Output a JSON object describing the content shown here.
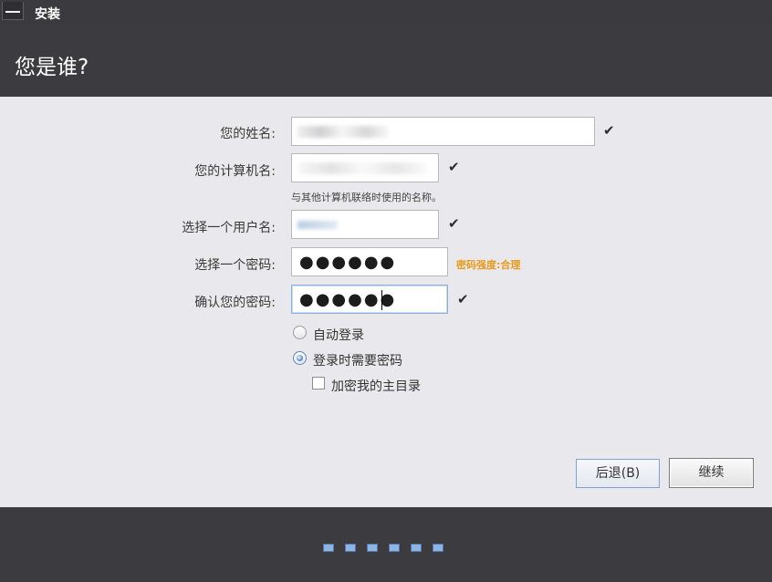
{
  "window": {
    "title": "安装"
  },
  "header": {
    "title": "您是谁?"
  },
  "form": {
    "name_label": "您的姓名:",
    "computer_label": "您的计算机名:",
    "computer_hint": "与其他计算机联络时使用的名称。",
    "username_label": "选择一个用户名:",
    "password_label": "选择一个密码:",
    "password_value": "●●●●●●",
    "password_strength": "密码强度:合理",
    "confirm_label": "确认您的密码:",
    "confirm_value": "●●●●●●",
    "check_glyph": "✔"
  },
  "login_options": {
    "auto_login": "自动登录",
    "require_password": "登录时需要密码",
    "selected": "require_password",
    "encrypt_home": "加密我的主目录",
    "encrypt_home_checked": false
  },
  "buttons": {
    "back": "后退(B)",
    "next": "继续"
  },
  "footer": {
    "steps_total": 6
  },
  "colors": {
    "header_bg": "#3c3b40",
    "content_bg": "#e9e8ec",
    "strength_color": "#e79b1c",
    "accent": "#5d86bb"
  }
}
